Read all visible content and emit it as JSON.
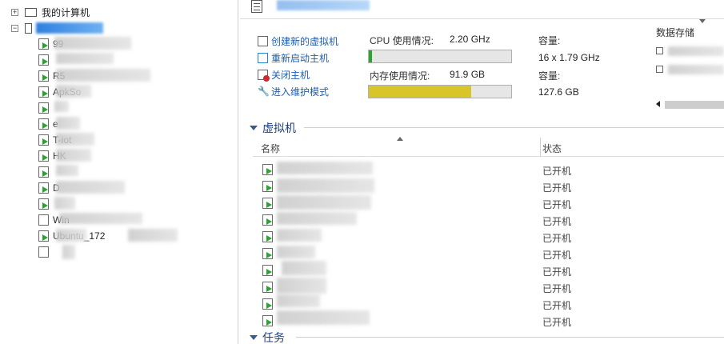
{
  "tree": {
    "root": {
      "label": "我的计算机",
      "expander": "+"
    },
    "host": {
      "expander": "−"
    },
    "vms": [
      {
        "text": "99",
        "on": true
      },
      {
        "text": "",
        "on": true
      },
      {
        "text": "R5",
        "on": true
      },
      {
        "text": "ApkSo",
        "on": true
      },
      {
        "text": "",
        "on": true
      },
      {
        "text": "e",
        "on": true
      },
      {
        "text": "T-iot",
        "on": true
      },
      {
        "text": "HK",
        "on": true
      },
      {
        "text": "",
        "on": true
      },
      {
        "text": "D",
        "on": true
      },
      {
        "text": "",
        "on": true
      },
      {
        "text": "Win",
        "on": false
      },
      {
        "text": "Ubuntu_172",
        "on": true
      },
      {
        "text": "",
        "on": false
      }
    ],
    "vm_texts_extra": {
      "d_suffix": "0F69C9D",
      "ubuntu_suffix": "97",
      "last": "义",
      "r5_prefix": "",
      "win_prefix": "主"
    }
  },
  "header": {
    "doc_icon": "document-icon"
  },
  "actions": [
    {
      "label": "创建新的虚拟机",
      "icon": "new-vm-icon"
    },
    {
      "label": "重新启动主机",
      "icon": "restart-icon"
    },
    {
      "label": "关闭主机",
      "icon": "shutdown-icon"
    },
    {
      "label": "进入维护模式",
      "icon": "wrench-icon"
    }
  ],
  "cpu": {
    "label": "CPU 使用情况:",
    "value": "2.20 GHz",
    "capacity_label": "容量:",
    "capacity": "16 x 1.79 GHz",
    "usage_fraction": 0.02,
    "color": "#2aa530"
  },
  "memory": {
    "label": "内存使用情况:",
    "value": "91.9 GB",
    "capacity_label": "容量:",
    "capacity": "127.6 GB",
    "usage_fraction": 0.72,
    "color": "#d8c52a"
  },
  "datastore": {
    "title": "数据存储"
  },
  "vm_section": {
    "title": "虚拟机",
    "col_name": "名称",
    "col_state": "状态",
    "rows": [
      {
        "state": "已开机"
      },
      {
        "state": "已开机"
      },
      {
        "state": "已开机"
      },
      {
        "state": "已开机"
      },
      {
        "state": "已开机"
      },
      {
        "state": "已开机"
      },
      {
        "state": "已开机"
      },
      {
        "state": "已开机"
      },
      {
        "state": "已开机"
      },
      {
        "state": "已开机"
      }
    ]
  },
  "tasks_section": {
    "title": "任务"
  }
}
